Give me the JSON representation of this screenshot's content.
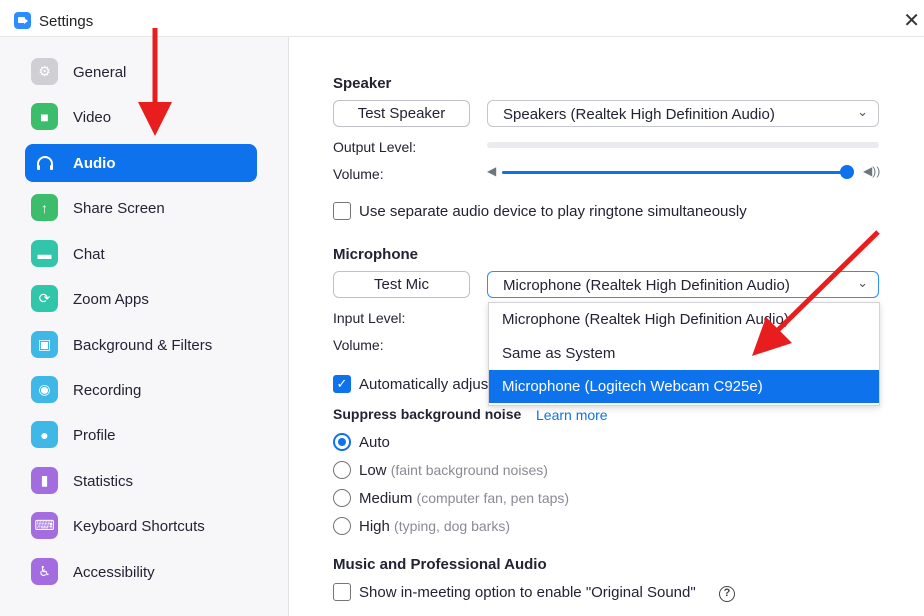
{
  "window": {
    "title": "Settings"
  },
  "sidebar": {
    "items": [
      {
        "label": "General",
        "icon": "gear-icon",
        "color": "#d0d0d4",
        "glyph": "⚙"
      },
      {
        "label": "Video",
        "icon": "video-camera-icon",
        "color": "#3bbd6b",
        "glyph": "■"
      },
      {
        "label": "Audio",
        "icon": "headphones-icon",
        "color": "#0e72ed",
        "glyph": "∩",
        "active": true
      },
      {
        "label": "Share Screen",
        "icon": "share-screen-icon",
        "color": "#3bbd6b",
        "glyph": "↑"
      },
      {
        "label": "Chat",
        "icon": "chat-bubble-icon",
        "color": "#31c5a9",
        "glyph": "▬"
      },
      {
        "label": "Zoom Apps",
        "icon": "zoom-apps-icon",
        "color": "#31c5a9",
        "glyph": "⟳"
      },
      {
        "label": "Background & Filters",
        "icon": "background-icon",
        "color": "#3fb8e8",
        "glyph": "▣"
      },
      {
        "label": "Recording",
        "icon": "record-icon",
        "color": "#3fb8e8",
        "glyph": "◉"
      },
      {
        "label": "Profile",
        "icon": "profile-icon",
        "color": "#3fb8e8",
        "glyph": "●"
      },
      {
        "label": "Statistics",
        "icon": "statistics-icon",
        "color": "#a36de0",
        "glyph": "▮"
      },
      {
        "label": "Keyboard Shortcuts",
        "icon": "keyboard-icon",
        "color": "#a36de0",
        "glyph": "⌨"
      },
      {
        "label": "Accessibility",
        "icon": "accessibility-icon",
        "color": "#a36de0",
        "glyph": "♿"
      }
    ]
  },
  "speaker": {
    "title": "Speaker",
    "test_button": "Test Speaker",
    "device": "Speakers (Realtek High Definition Audio)",
    "output_level_label": "Output Level:",
    "volume_label": "Volume:",
    "volume_level": 1.0
  },
  "ringtone": {
    "label": "Use separate audio device to play ringtone simultaneously",
    "checked": false
  },
  "microphone": {
    "title": "Microphone",
    "test_button": "Test Mic",
    "device": "Microphone (Realtek High Definition Audio)",
    "input_level_label": "Input Level:",
    "volume_label": "Volume:",
    "auto_adjust_label": "Automatically adjus",
    "auto_adjust_checked": true,
    "options": [
      "Microphone (Realtek High Definition Audio)",
      "Same as System",
      "Microphone (Logitech Webcam C925e)"
    ],
    "highlighted_option": 2
  },
  "noise": {
    "title": "Suppress background noise",
    "learn_more": "Learn more",
    "options": [
      {
        "label": "Auto",
        "hint": ""
      },
      {
        "label": "Low",
        "hint": "(faint background noises)"
      },
      {
        "label": "Medium",
        "hint": "(computer fan, pen taps)"
      },
      {
        "label": "High",
        "hint": "(typing, dog barks)"
      }
    ],
    "selected": 0
  },
  "music": {
    "title": "Music and Professional Audio",
    "original_sound_label": "Show in-meeting option to enable \"Original Sound\"",
    "checked": false,
    "help": "?"
  },
  "colors": {
    "accent": "#0e72ed",
    "annotation": "#e81d1d"
  }
}
